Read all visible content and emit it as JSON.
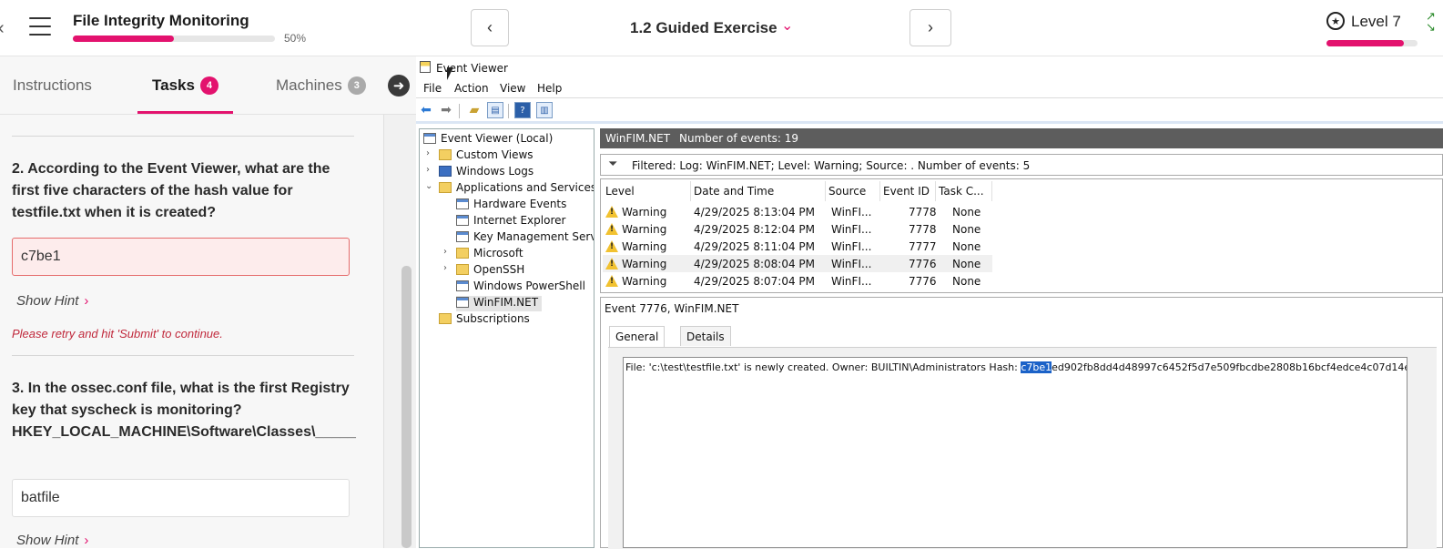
{
  "header": {
    "course_title": "File Integrity Monitoring",
    "progress_percent_label": "50%",
    "progress_fraction": 0.5,
    "exercise_title": "1.2 Guided Exercise",
    "level_label": "Level 7",
    "level_fraction": 0.85
  },
  "tabs": {
    "instructions": "Instructions",
    "tasks": "Tasks",
    "tasks_count": "4",
    "machines": "Machines",
    "machines_count": "3"
  },
  "tasks": {
    "q2": {
      "question": "2. According to the Event Viewer, what are the first five characters of the hash value for testfile.txt when it is created?",
      "answer": "c7be1",
      "hint": "Show Hint",
      "retry_message": "Please retry and hit 'Submit' to continue."
    },
    "q3": {
      "question": "3. In the ossec.conf file, what is the first Registry key that syscheck is monitoring? HKEY_LOCAL_MACHINE\\Software\\Classes\\_____",
      "answer": "batfile",
      "hint": "Show Hint"
    }
  },
  "event_viewer": {
    "title": "Event Viewer",
    "menu": [
      "File",
      "Action",
      "View",
      "Help"
    ],
    "tree": {
      "root": "Event Viewer (Local)",
      "custom_views": "Custom Views",
      "windows_logs": "Windows Logs",
      "apps_services": "Applications and Services Lo",
      "hardware_events": "Hardware Events",
      "internet_explorer": "Internet Explorer",
      "key_management": "Key Management Service",
      "microsoft": "Microsoft",
      "openssh": "OpenSSH",
      "powershell": "Windows PowerShell",
      "winfim": "WinFIM.NET",
      "subscriptions": "Subscriptions"
    },
    "log_name": "WinFIM.NET",
    "event_count": "Number of events: 19",
    "filter_text": "Filtered: Log: WinFIM.NET; Level: Warning; Source: . Number of events: 5",
    "columns": [
      "Level",
      "Date and Time",
      "Source",
      "Event ID",
      "Task C..."
    ],
    "rows": [
      {
        "level": "Warning",
        "datetime": "4/29/2025 8:13:04 PM",
        "source": "WinFI...",
        "event_id": "7778",
        "task": "None"
      },
      {
        "level": "Warning",
        "datetime": "4/29/2025 8:12:04 PM",
        "source": "WinFI...",
        "event_id": "7778",
        "task": "None"
      },
      {
        "level": "Warning",
        "datetime": "4/29/2025 8:11:04 PM",
        "source": "WinFI...",
        "event_id": "7777",
        "task": "None"
      },
      {
        "level": "Warning",
        "datetime": "4/29/2025 8:08:04 PM",
        "source": "WinFI...",
        "event_id": "7776",
        "task": "None"
      },
      {
        "level": "Warning",
        "datetime": "4/29/2025 8:07:04 PM",
        "source": "WinFI...",
        "event_id": "7776",
        "task": "None"
      }
    ],
    "detail": {
      "header": "Event 7776, WinFIM.NET",
      "tab_general": "General",
      "tab_details": "Details",
      "desc_prefix": "File: 'c:\\test\\testfile.txt' is newly created. Owner: BUILTIN\\Administrators Hash: ",
      "hash_selected": "c7be1",
      "hash_rest": "ed902fb8dd4d48997c6452f5d7e509fbcdbe2808b16bcf4edce4c07d14e"
    }
  },
  "colors": {
    "accent": "#e3126e",
    "error": "#c0283b",
    "selection": "#1b62c8"
  }
}
